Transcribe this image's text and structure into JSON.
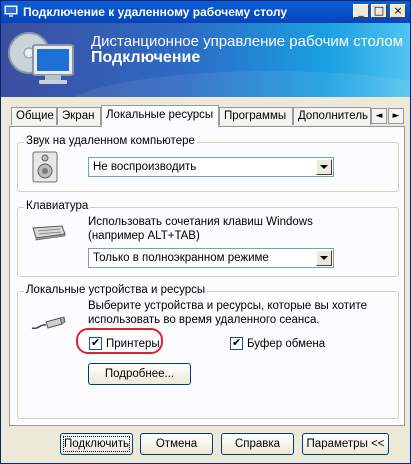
{
  "window": {
    "title": "Подключение к удаленному рабочему столу"
  },
  "title_buttons": {
    "minimize": "_",
    "maximize": "□",
    "close": "×"
  },
  "banner": {
    "line1": "Дистанционное управление рабочим столом",
    "line2": "Подключение"
  },
  "tabs": [
    {
      "label": "Общие"
    },
    {
      "label": "Экран"
    },
    {
      "label": "Локальные ресурсы"
    },
    {
      "label": "Программы"
    },
    {
      "label": "Дополнитель"
    }
  ],
  "active_tab": "Локальные ресурсы",
  "tab_scroll": {
    "left": "◄",
    "right": "►"
  },
  "sound": {
    "group_title": "Звук на удаленном компьютере",
    "value": "Не воспроизводить"
  },
  "keyboard": {
    "group_title": "Клавиатура",
    "description_line1": "Использовать сочетания клавиш Windows",
    "description_line2": "(например ALT+TAB)",
    "value": "Только в полноэкранном режиме"
  },
  "devices": {
    "group_title": "Локальные устройства и ресурсы",
    "description_line1": "Выберите устройства и ресурсы, которые вы хотите",
    "description_line2": "использовать во время удаленного сеанса.",
    "printers_label": "Принтеры",
    "printers_checked": true,
    "clipboard_label": "Буфер обмена",
    "clipboard_checked": true,
    "more_button": "Подробнее..."
  },
  "footer": {
    "connect": "Подключить",
    "cancel": "Отмена",
    "help": "Справка",
    "options": "Параметры <<"
  },
  "colors": {
    "highlight_ring": "#e2212b",
    "titlebar": "#0a5fd8"
  }
}
